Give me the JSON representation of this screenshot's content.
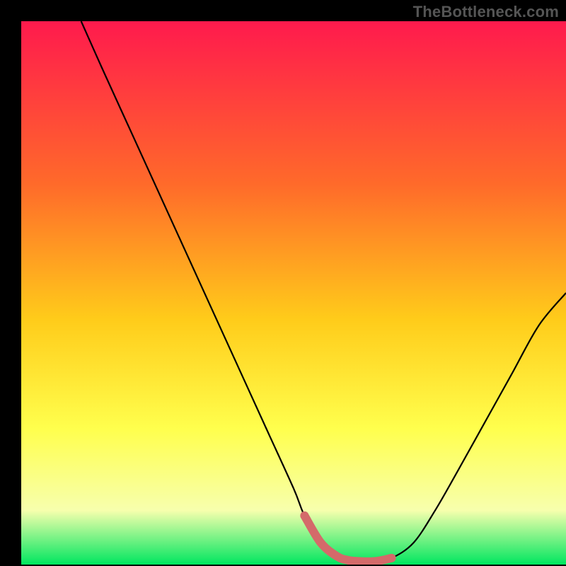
{
  "watermark": "TheBottleneck.com",
  "colors": {
    "bg_black": "#000000",
    "grad_top": "#ff1a4d",
    "grad_mid1": "#ff6a2a",
    "grad_mid2": "#ffcc1a",
    "grad_mid3": "#ffff4d",
    "grad_mid4": "#f7ffad",
    "grad_bottom": "#00e660",
    "curve": "#000000",
    "marker": "#d46a6a"
  },
  "chart_data": {
    "type": "line",
    "title": "",
    "xlabel": "",
    "ylabel": "",
    "xlim": [
      0,
      100
    ],
    "ylim": [
      0,
      100
    ],
    "series": [
      {
        "name": "curve",
        "x": [
          11,
          15,
          20,
          25,
          30,
          35,
          40,
          45,
          50,
          52,
          55,
          58,
          60,
          62,
          65,
          68,
          72,
          76,
          80,
          85,
          90,
          95,
          100
        ],
        "y": [
          100,
          91,
          80,
          69,
          58,
          47,
          36,
          25,
          14,
          9,
          4,
          1.5,
          0.8,
          0.6,
          0.6,
          1.2,
          4,
          10,
          17,
          26,
          35,
          44,
          50
        ]
      },
      {
        "name": "marker-segment",
        "x": [
          52,
          55,
          58,
          60,
          62,
          65,
          68
        ],
        "y": [
          9,
          4,
          1.5,
          0.8,
          0.6,
          0.6,
          1.2
        ]
      }
    ],
    "gradient_stops": [
      {
        "offset": 0.0,
        "key": "grad_top"
      },
      {
        "offset": 0.3,
        "key": "grad_mid1"
      },
      {
        "offset": 0.55,
        "key": "grad_mid2"
      },
      {
        "offset": 0.75,
        "key": "grad_mid3"
      },
      {
        "offset": 0.9,
        "key": "grad_mid4"
      },
      {
        "offset": 1.0,
        "key": "grad_bottom"
      }
    ]
  }
}
